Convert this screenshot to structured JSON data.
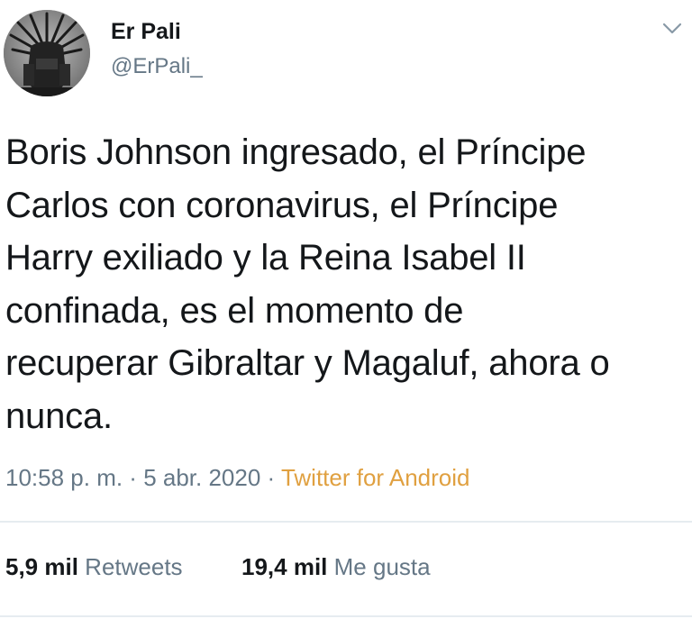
{
  "author": {
    "name": "Er Pali",
    "handle": "@ErPali_",
    "avatar_icon": "iron-throne-avatar"
  },
  "menu_icon": "chevron-down-icon",
  "tweet": {
    "text": "Boris Johnson ingresado, el Príncipe\nCarlos con coronavirus, el Príncipe\nHarry exiliado y la Reina Isabel II\nconfinada, es el momento de\nrecuperar Gibraltar y Magaluf, ahora o\nnunca.",
    "time": "10:58 p. m.",
    "separator1": " · ",
    "date": "5 abr. 2020",
    "separator2": " · ",
    "source": "Twitter for Android"
  },
  "stats": {
    "retweets_count": "5,9 mil",
    "retweets_label": "Retweets",
    "likes_count": "19,4 mil",
    "likes_label": "Me gusta"
  },
  "colors": {
    "text": "#14171a",
    "secondary": "#657786",
    "source_link": "#e0a040",
    "divider": "#e6ecf0"
  }
}
